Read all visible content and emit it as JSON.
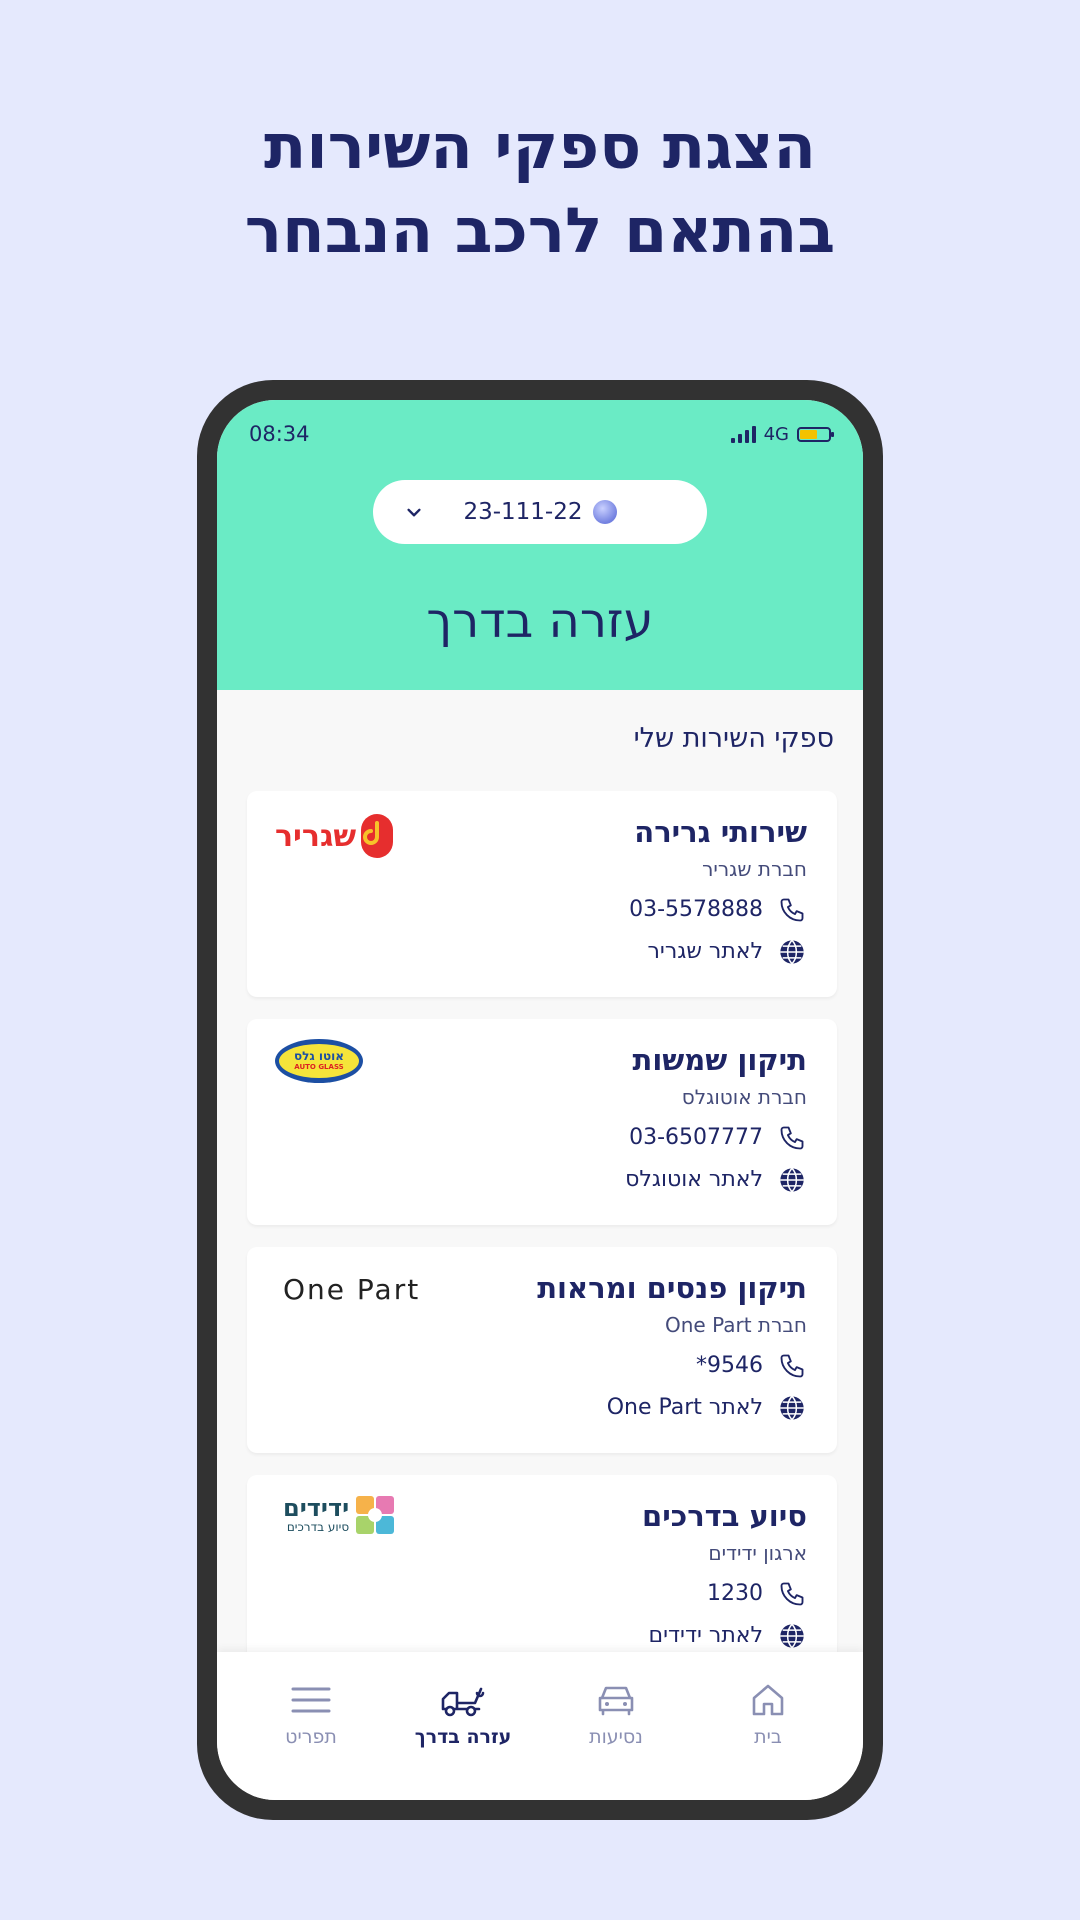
{
  "headline": {
    "line1": "הצגת ספקי השירות",
    "line2": "בהתאם לרכב הנבחר"
  },
  "status_bar": {
    "time": "08:34",
    "network": "4G",
    "battery_color": "#f4c200"
  },
  "vehicle_selector": {
    "plate": "23-111-22",
    "icon": "car-globe-icon",
    "chevron": "chevron-down-icon"
  },
  "page_title": "עזרה בדרך",
  "section_title": "ספקי השירות שלי",
  "providers": [
    {
      "title": "שירותי גרירה",
      "company": "חברת שגריר",
      "phone": "03-5578888",
      "website_label": "לאתר שגריר",
      "logo_text": "שגריר",
      "logo_color": "#e62e2e"
    },
    {
      "title": "תיקון שמשות",
      "company": "חברת אוטוגלס",
      "phone": "03-6507777",
      "website_label": "לאתר אוטוגלס",
      "logo_text_top": "אוטו גלס",
      "logo_text_bottom": "AUTO GLASS",
      "logo_color": "#f5e43a"
    },
    {
      "title": "תיקון פנסים ומראות",
      "company": "חברת One Part",
      "phone": "*9546",
      "website_label": "לאתר One Part",
      "logo_text": "One Part"
    },
    {
      "title": "סיוע בדרכים",
      "company": "ארגון ידידים",
      "phone": "1230",
      "website_label": "לאתר ידידים",
      "logo_text_top": "ידידים",
      "logo_text_bottom": "סיוע בדרכים"
    }
  ],
  "nav": [
    {
      "label": "תפריט",
      "icon": "menu-icon",
      "active": false
    },
    {
      "label": "עזרה בדרך",
      "icon": "tow-truck-icon",
      "active": true
    },
    {
      "label": "נסיעות",
      "icon": "car-icon",
      "active": false
    },
    {
      "label": "בית",
      "icon": "home-icon",
      "active": false
    }
  ],
  "colors": {
    "accent": "#6aebc5",
    "primary": "#1e2565",
    "background": "#e5e9fd"
  }
}
